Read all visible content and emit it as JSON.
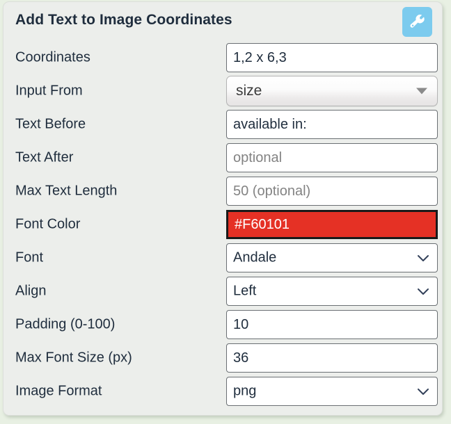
{
  "panel": {
    "title": "Add Text to Image Coordinates",
    "tool_button_icon": "wrench-icon",
    "accent_color": "#7CCBEE"
  },
  "form": {
    "rows": [
      {
        "label": "Coordinates",
        "control": "text",
        "name": "coordinates",
        "value": "1,2 x 6,3",
        "placeholder": ""
      },
      {
        "label": "Input From",
        "control": "select-native",
        "name": "input-from",
        "value": "size",
        "icon": "triangle-down-icon"
      },
      {
        "label": "Text Before",
        "control": "text",
        "name": "text-before",
        "value": "available in:",
        "placeholder": ""
      },
      {
        "label": "Text After",
        "control": "text",
        "name": "text-after",
        "value": "",
        "placeholder": "optional"
      },
      {
        "label": "Max Text Length",
        "control": "text",
        "name": "max-text-length",
        "value": "",
        "placeholder": "50 (optional)"
      },
      {
        "label": "Font Color",
        "control": "color",
        "name": "font-color",
        "value": "#F60101",
        "placeholder": "",
        "swatch_color": "#E53125"
      },
      {
        "label": "Font",
        "control": "select",
        "name": "font",
        "value": "Andale",
        "icon": "chevron-down-icon"
      },
      {
        "label": "Align",
        "control": "select",
        "name": "align",
        "value": "Left",
        "icon": "chevron-down-icon"
      },
      {
        "label": "Padding (0-100)",
        "control": "text",
        "name": "padding",
        "value": "10",
        "placeholder": ""
      },
      {
        "label": "Max Font Size (px)",
        "control": "text",
        "name": "max-font-size",
        "value": "36",
        "placeholder": ""
      },
      {
        "label": "Image Format",
        "control": "select",
        "name": "image-format",
        "value": "png",
        "icon": "chevron-down-icon"
      }
    ]
  }
}
